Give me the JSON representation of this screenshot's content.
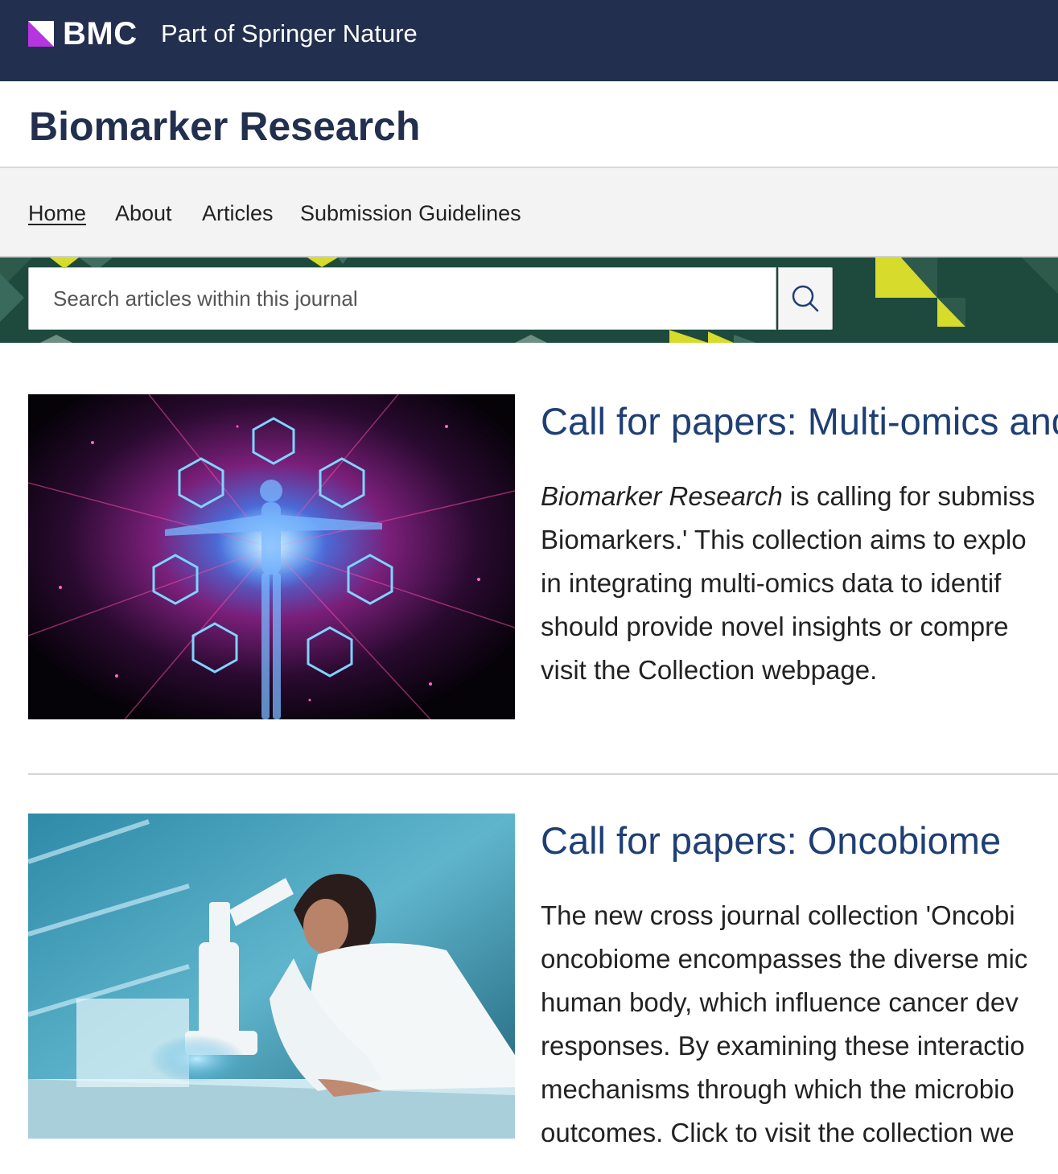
{
  "header": {
    "brand": "BMC",
    "tagline": "Part of Springer Nature"
  },
  "journal": {
    "title": "Biomarker Research"
  },
  "nav": {
    "items": [
      {
        "label": "Home"
      },
      {
        "label": "About"
      },
      {
        "label": "Articles"
      },
      {
        "label": "Submission Guidelines"
      }
    ]
  },
  "search": {
    "placeholder": "Search articles within this journal",
    "button_icon": "search-icon"
  },
  "articles": [
    {
      "title": "Call for papers: Multi-omics and",
      "lines": [
        {
          "italic": "Biomarker Research",
          "text": " is calling for submiss"
        },
        {
          "italic": "",
          "text": "Biomarkers.' This collection aims to explo"
        },
        {
          "italic": "",
          "text": "in integrating multi-omics data to identif"
        },
        {
          "italic": "",
          "text": "should provide novel insights or compre"
        },
        {
          "italic": "",
          "text": "visit the Collection webpage."
        }
      ]
    },
    {
      "title": "Call for papers: Oncobiome",
      "lines": [
        {
          "italic": "",
          "text": "The new cross journal collection 'Oncobi"
        },
        {
          "italic": "",
          "text": "oncobiome encompasses the diverse mic"
        },
        {
          "italic": "",
          "text": "human body, which influence cancer dev"
        },
        {
          "italic": "",
          "text": "responses. By examining these interactio"
        },
        {
          "italic": "",
          "text": "mechanisms through which the microbio"
        },
        {
          "italic": "",
          "text": "outcomes. Click to visit the collection we"
        }
      ]
    }
  ],
  "colors": {
    "topbar": "#222f4e",
    "brand_accent": "#b535e0",
    "search_band": "#1d4a3c",
    "deco_yellow": "#d6db2c",
    "title_blue": "#1f3f74"
  }
}
